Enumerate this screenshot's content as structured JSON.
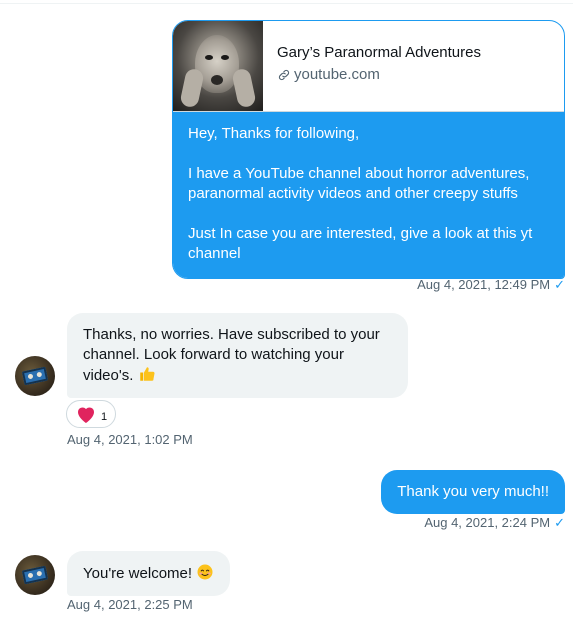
{
  "conversation": {
    "link_card": {
      "title": "Gary’s Paranormal Adventures",
      "domain": "youtube.com",
      "message_paragraphs": [
        "Hey, Thanks for following,",
        "I have a YouTube channel about horror adventures, paranormal activity videos and other creepy stuffs",
        "Just In case you are interested, give a look at this yt channel"
      ],
      "timestamp": "Aug 4, 2021, 12:49 PM"
    },
    "reply_1": {
      "text": "Thanks, no worries. Have subscribed to your channel. Look forward to watching your video's.",
      "reaction_count": "1",
      "timestamp": "Aug 4, 2021, 1:02 PM"
    },
    "sent_2": {
      "text": "Thank you very much!!",
      "timestamp": "Aug 4, 2021, 2:24 PM"
    },
    "reply_2": {
      "text": "You're welcome!",
      "timestamp": "Aug 4, 2021, 2:25 PM"
    }
  },
  "icons": {
    "link": "link-icon",
    "seen": "checkmark-icon",
    "reaction": "heart-icon",
    "thumbs_up": "thumbs-up-emoji",
    "smile": "smiling-face-emoji"
  },
  "colors": {
    "accent": "#1d9bf0",
    "received_bubble": "#eff3f4",
    "muted_text": "#536471",
    "heart": "#f91880"
  }
}
